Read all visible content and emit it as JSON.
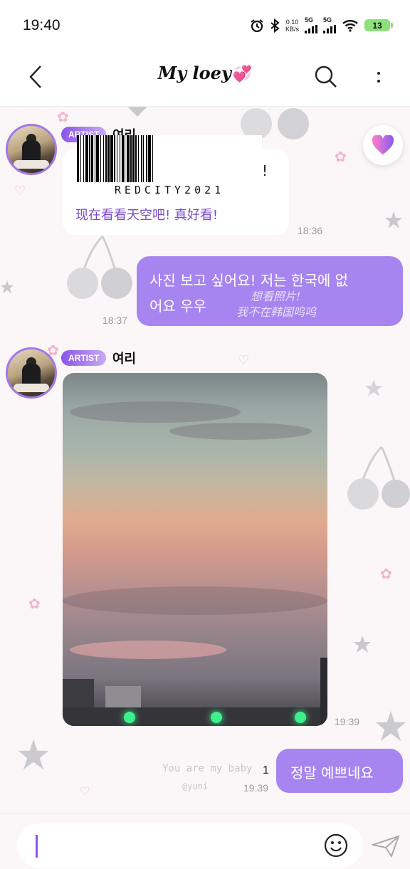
{
  "status_bar": {
    "time": "19:40",
    "net_speed_value": "0.10",
    "net_speed_unit": "KB/s",
    "signal_1": "5G",
    "signal_2": "5G",
    "battery": "13",
    "icons": [
      "alarm-icon",
      "bluetooth-icon",
      "wifi-icon"
    ]
  },
  "header": {
    "title": "My loey",
    "title_emoji": "💞",
    "icons": [
      "back-icon",
      "search-icon",
      "more-vertical-icon"
    ]
  },
  "messages": [
    {
      "side": "left",
      "badge": "ARTIST",
      "sender": "여리",
      "line1_visible_end": "!",
      "line2": "现在看看天空吧! 真好看!",
      "barcode_text": "REDCITY2021",
      "time": "18:36"
    },
    {
      "side": "right",
      "text_line1": "사진 보고 싶어요! 저는 한국에 없",
      "text_line2": "어요 우우",
      "overlay_line1": "想看照片!",
      "overlay_line2": "我不在韩国呜呜",
      "time": "18:37"
    },
    {
      "side": "left",
      "badge": "ARTIST",
      "sender": "여리",
      "type": "image",
      "time": "19:39"
    },
    {
      "side": "right",
      "text": "정말 예쁘네요",
      "read_count": "1",
      "time": "19:39",
      "watermark_1": "You are my baby",
      "watermark_2": "@yuni"
    }
  ],
  "fab": {
    "icon": "heart-icon",
    "color": "#9b6cf0"
  },
  "composer": {
    "placeholder": "",
    "icons": [
      "emoji-icon",
      "send-icon"
    ]
  },
  "colors": {
    "accent": "#a685f0",
    "badge_start": "#8a55e8",
    "badge_end": "#c8a9f5"
  }
}
